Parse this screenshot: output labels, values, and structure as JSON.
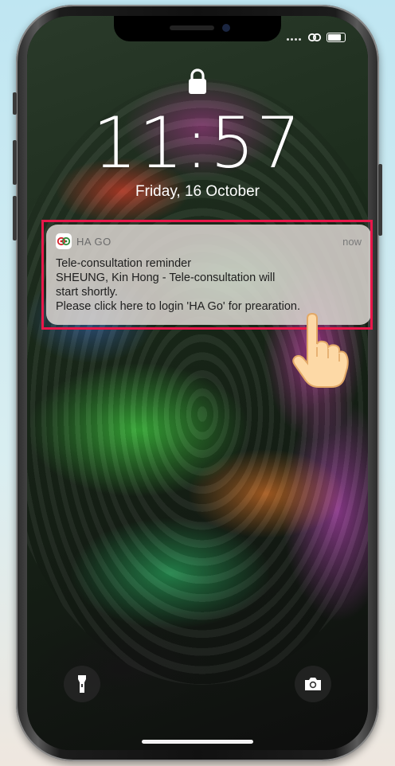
{
  "lock_screen": {
    "time": "11:57",
    "date": "Friday, 16 October"
  },
  "notification": {
    "app_name": "HA GO",
    "time": "now",
    "title": "Tele-consultation reminder",
    "body_lines": [
      "SHEUNG, Kin Hong - Tele-consultation will",
      "start shortly.",
      "Please click here to login 'HA Go' for prearation."
    ]
  },
  "icons": {
    "lock": "lock-icon",
    "flashlight": "flashlight-icon",
    "camera": "camera-icon",
    "pointer": "pointing-hand-icon",
    "app": "ha-go-app-icon",
    "link": "link-icon",
    "battery": "battery-icon"
  },
  "colors": {
    "highlight": "#e8174a",
    "notification_bg": "#d7d2cd",
    "app_icon_red": "#d6202a",
    "app_icon_green": "#2e8b3a"
  }
}
